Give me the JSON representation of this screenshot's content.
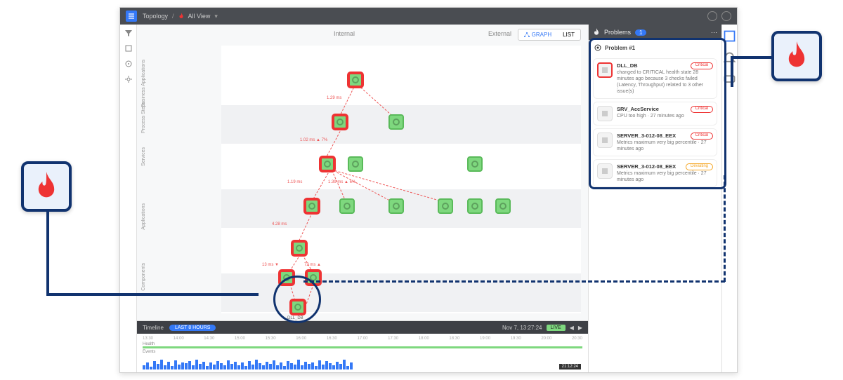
{
  "topbar": {
    "crumb1": "Topology",
    "crumb2": "All View",
    "fire_icon": "fire-icon"
  },
  "leftbar_icons": [
    "filter-icon",
    "square-icon",
    "target-icon",
    "settings-icon"
  ],
  "columns": {
    "internal": "Internal",
    "external": "External"
  },
  "view_toggle": {
    "graph": "GRAPH",
    "list": "LIST"
  },
  "row_labels": [
    "Business Applications",
    "Process Steps",
    "Services",
    "Applications",
    "Components"
  ],
  "panel": {
    "title": "Problems",
    "count": "1",
    "problem_heading": "Problem #1",
    "items": [
      {
        "name": "DLL_DB",
        "status": "Critical",
        "alert": true,
        "desc": "changed to CRITICAL health state 28 minutes ago because 3 checks failed (Latency, Throughput) related to 3 other issue(s)"
      },
      {
        "name": "SRV_AccService",
        "status": "Critical",
        "alert": false,
        "desc": "CPU too high · 27 minutes ago"
      },
      {
        "name": "SERVER_3-012-08_EEX",
        "status": "Critical",
        "alert": false,
        "desc": "Metrics maximum very big percentile · 27 minutes ago"
      },
      {
        "name": "SERVER_3-012-08_EEX",
        "status": "Deviating",
        "alert": false,
        "desc": "Metrics maximum very big percentile · 27 minutes ago"
      }
    ]
  },
  "timeline": {
    "title": "Timeline",
    "range": "LAST 8 HOURS",
    "ticks": [
      "13:30",
      "14:00",
      "14:30",
      "15:00",
      "15:30",
      "16:00",
      "16:30",
      "17:00",
      "17:30",
      "18:00",
      "18:30",
      "19:00",
      "19:30",
      "20:00",
      "20:30"
    ],
    "row_health": "Health",
    "row_events": "Events",
    "stamp": "Nov 7, 13:27:24",
    "live": "LIVE",
    "end": "21:12:24"
  },
  "edge_labels": [
    "1.29 ms",
    "1.02 ms ▲ 7%",
    "1.19 ms",
    "1.39 ms ▲ 6%",
    "4.28 ms",
    "13 ms ▼",
    "72 ms ▲"
  ],
  "bottom_node_label": "DLL_DB"
}
